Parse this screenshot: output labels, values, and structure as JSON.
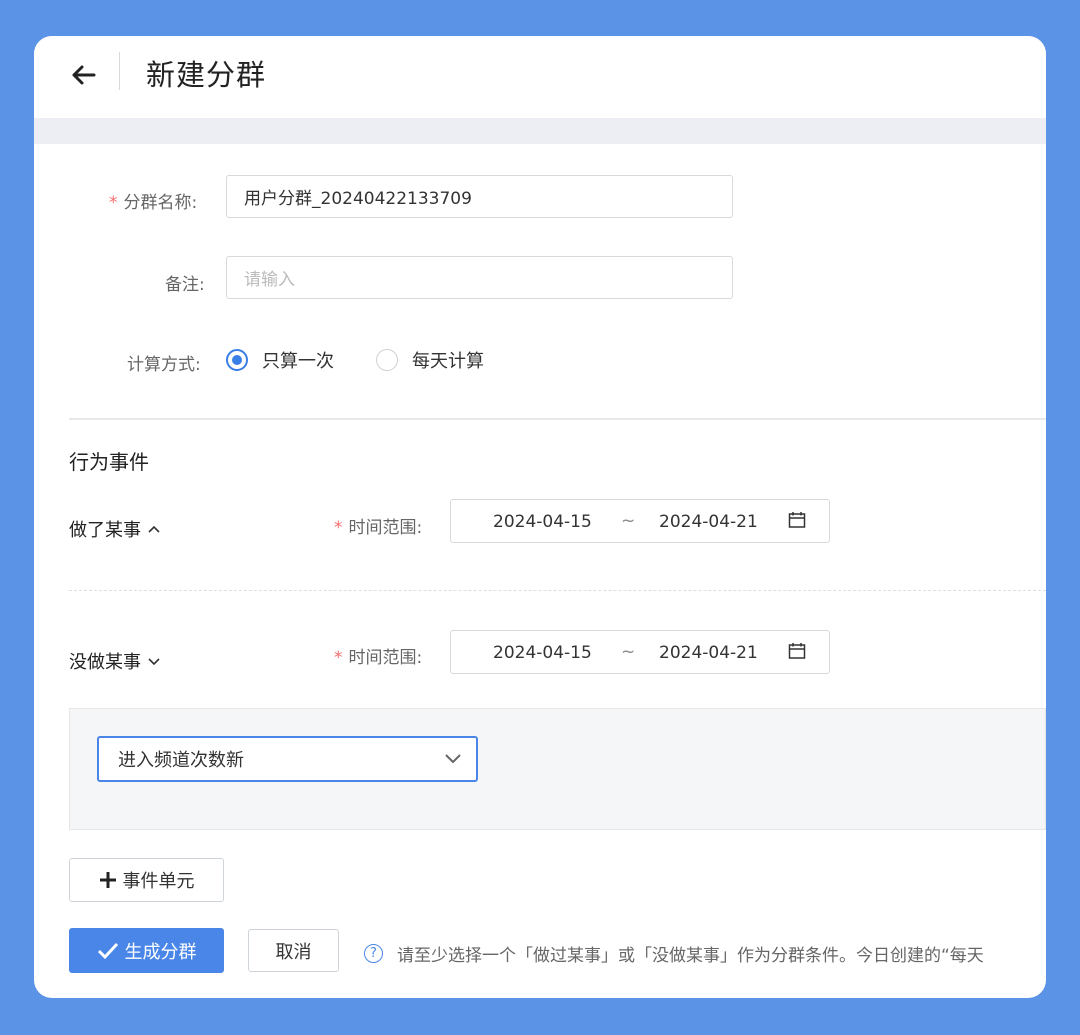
{
  "header": {
    "title": "新建分群",
    "back_icon": "arrow-left-icon"
  },
  "form": {
    "name_label": "分群名称:",
    "name_value": "用户分群_20240422133709",
    "remark_label": "备注:",
    "remark_placeholder": "请输入",
    "calc_label": "计算方式:",
    "calc_options": [
      {
        "label": "只算一次",
        "checked": true
      },
      {
        "label": "每天计算",
        "checked": false
      }
    ]
  },
  "events": {
    "section_title": "行为事件",
    "did": {
      "label": "做了某事",
      "expanded": true,
      "range_label": "时间范围:",
      "start": "2024-04-15",
      "sep": "~",
      "end": "2024-04-21"
    },
    "did_not": {
      "label": "没做某事",
      "expanded": false,
      "range_label": "时间范围:",
      "start": "2024-04-15",
      "sep": "~",
      "end": "2024-04-21"
    },
    "condition_select": "进入频道次数新",
    "add_unit_label": "事件单元"
  },
  "actions": {
    "submit_label": "生成分群",
    "cancel_label": "取消",
    "tip_text": "请至少选择一个「做过某事」或「没做某事」作为分群条件。今日创建的“每天"
  },
  "colors": {
    "background": "#5b93e6",
    "primary": "#4a86e8",
    "required": "#f56c6c"
  }
}
